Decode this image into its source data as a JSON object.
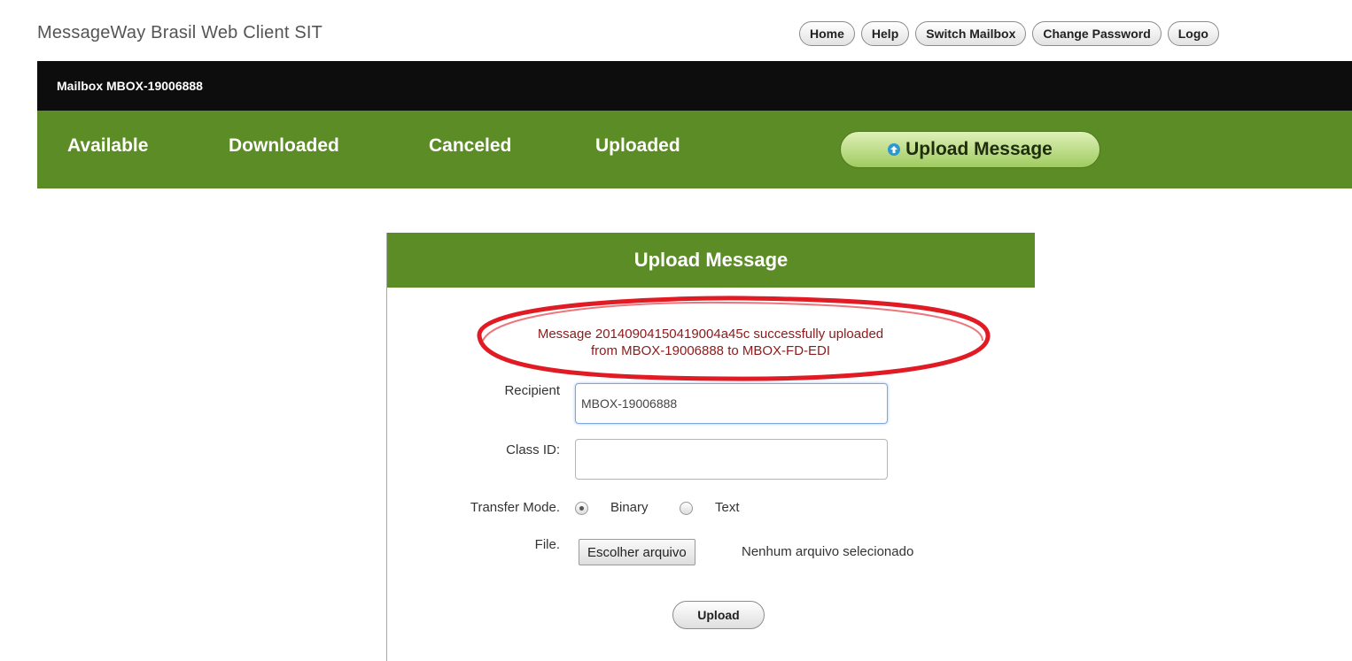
{
  "app": {
    "title": "MessageWay Brasil Web Client   SIT"
  },
  "topnav": {
    "home": "Home",
    "help": "Help",
    "switch_mailbox": "Switch Mailbox",
    "change_password": "Change Password",
    "logout": "Logo"
  },
  "mailbox_bar": {
    "label": "Mailbox MBOX-19006888"
  },
  "nav": {
    "tabs": [
      "Available",
      "Downloaded",
      "Canceled",
      "Uploaded"
    ],
    "upload_button": "Upload Message"
  },
  "panel": {
    "title": "Upload Message",
    "success_line1": "Message 20140904150419004a45c successfully uploaded",
    "success_line2": "from MBOX-19006888 to MBOX-FD-EDI",
    "recipient_label": "Recipient",
    "recipient_value": "MBOX-19006888",
    "class_id_label": "Class ID:",
    "class_id_value": "",
    "transfer_mode_label": "Transfer Mode.",
    "transfer_modes": [
      "Binary",
      "Text"
    ],
    "transfer_mode_selected": "Binary",
    "file_label": "File.",
    "file_button": "Escolher arquivo",
    "file_status": "Nenhum arquivo selecionado",
    "upload_button": "Upload"
  },
  "colors": {
    "nav_green": "#5b8c25",
    "mailbox_bar": "#0d0d0d",
    "highlight_oval": "#e01b24",
    "success_text": "#8b1a1a"
  }
}
